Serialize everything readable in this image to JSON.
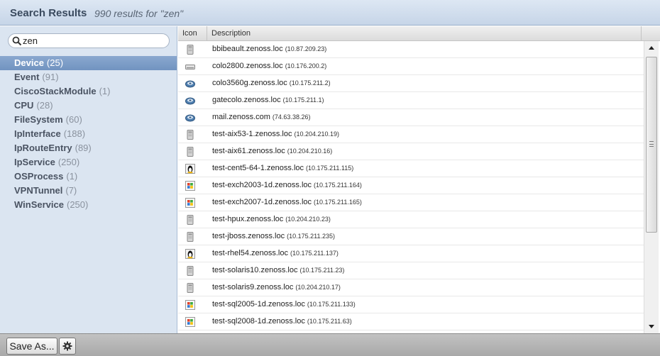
{
  "header": {
    "title": "Search Results",
    "subtitle": "990 results for \"zen\""
  },
  "search": {
    "value": "zen",
    "icon": "search-icon"
  },
  "categories": [
    {
      "label": "Device",
      "count": "(25)",
      "selected": true
    },
    {
      "label": "Event",
      "count": "(91)"
    },
    {
      "label": "CiscoStackModule",
      "count": "(1)"
    },
    {
      "label": "CPU",
      "count": "(28)"
    },
    {
      "label": "FileSystem",
      "count": "(60)"
    },
    {
      "label": "IpInterface",
      "count": "(188)"
    },
    {
      "label": "IpRouteEntry",
      "count": "(89)"
    },
    {
      "label": "IpService",
      "count": "(250)"
    },
    {
      "label": "OSProcess",
      "count": "(1)"
    },
    {
      "label": "VPNTunnel",
      "count": "(7)"
    },
    {
      "label": "WinService",
      "count": "(250)"
    }
  ],
  "grid": {
    "columns": [
      "Icon",
      "Description"
    ],
    "rows": [
      {
        "icon": "server-icon",
        "name": "bbibeault.zenoss.loc",
        "ip": "(10.87.209.23)"
      },
      {
        "icon": "router-icon",
        "name": "colo2800.zenoss.loc",
        "ip": "(10.176.200.2)"
      },
      {
        "icon": "switch-icon",
        "name": "colo3560g.zenoss.loc",
        "ip": "(10.175.211.2)"
      },
      {
        "icon": "switch-icon",
        "name": "gatecolo.zenoss.loc",
        "ip": "(10.175.211.1)"
      },
      {
        "icon": "switch-icon",
        "name": "mail.zenoss.com",
        "ip": "(74.63.38.26)"
      },
      {
        "icon": "server-icon",
        "name": "test-aix53-1.zenoss.loc",
        "ip": "(10.204.210.19)"
      },
      {
        "icon": "server-icon",
        "name": "test-aix61.zenoss.loc",
        "ip": "(10.204.210.16)"
      },
      {
        "icon": "linux-icon",
        "name": "test-cent5-64-1.zenoss.loc",
        "ip": "(10.175.211.115)"
      },
      {
        "icon": "windows-icon",
        "name": "test-exch2003-1d.zenoss.loc",
        "ip": "(10.175.211.164)"
      },
      {
        "icon": "windows-icon",
        "name": "test-exch2007-1d.zenoss.loc",
        "ip": "(10.175.211.165)"
      },
      {
        "icon": "server-icon",
        "name": "test-hpux.zenoss.loc",
        "ip": "(10.204.210.23)"
      },
      {
        "icon": "server-icon",
        "name": "test-jboss.zenoss.loc",
        "ip": "(10.175.211.235)"
      },
      {
        "icon": "linux-icon",
        "name": "test-rhel54.zenoss.loc",
        "ip": "(10.175.211.137)"
      },
      {
        "icon": "server-icon",
        "name": "test-solaris10.zenoss.loc",
        "ip": "(10.175.211.23)"
      },
      {
        "icon": "server-icon",
        "name": "test-solaris9.zenoss.loc",
        "ip": "(10.204.210.17)"
      },
      {
        "icon": "windows-icon",
        "name": "test-sql2005-1d.zenoss.loc",
        "ip": "(10.175.211.133)"
      },
      {
        "icon": "windows-icon",
        "name": "test-sql2008-1d.zenoss.loc",
        "ip": "(10.175.211.63)"
      }
    ]
  },
  "footer": {
    "save_label": "Save As...",
    "gear_icon": "gear-icon"
  },
  "colors": {
    "selected_row": "#7f9fca",
    "panel_bg": "#dbe5f1",
    "header_bg": "#c6d5e8"
  }
}
